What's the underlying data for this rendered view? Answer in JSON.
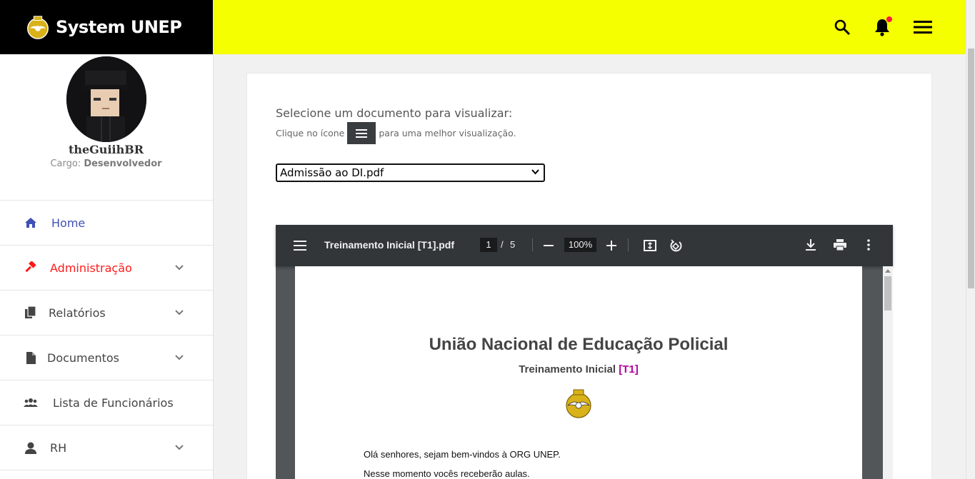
{
  "brand": {
    "name": "System UNEP",
    "logo_icon": "unep-emblem-icon"
  },
  "profile": {
    "username": "theGuiihBR",
    "role_label": "Cargo:",
    "role_value": "Desenvolvedor"
  },
  "sidebar": {
    "items": [
      {
        "label": "Home",
        "icon": "home-icon",
        "color": "#3f51b5",
        "has_chevron": false
      },
      {
        "label": "Administração",
        "icon": "gavel-icon",
        "color": "#ff1a1a",
        "has_chevron": true
      },
      {
        "label": "Relatórios",
        "icon": "files-icon",
        "color": "#444444",
        "has_chevron": true
      },
      {
        "label": "Documentos",
        "icon": "document-icon",
        "color": "#444444",
        "has_chevron": true
      },
      {
        "label": "Lista de Funcionários",
        "icon": "users-icon",
        "color": "#444444",
        "has_chevron": false
      },
      {
        "label": "RH",
        "icon": "user-icon",
        "color": "#444444",
        "has_chevron": true
      }
    ]
  },
  "header": {
    "background": "#f5ff00",
    "icons": [
      "search-icon",
      "bell-icon",
      "menu-icon"
    ],
    "notification_dot_color": "#ff1744"
  },
  "main": {
    "select_title": "Selecione um documento para visualizar:",
    "hint_before": "Clique no ícone",
    "hint_after": "para uma melhor visualização.",
    "selected_document": "Admissão ao DI.pdf"
  },
  "pdf_viewer": {
    "filename": "Treinamento Inicial [T1].pdf",
    "current_page": "1",
    "page_separator": "/",
    "total_pages": "5",
    "zoom": "100%",
    "document": {
      "title": "União Nacional de Educação Policial",
      "subtitle": "Treinamento Inicial",
      "subtitle_tag": "[T1]",
      "paragraphs": [
        "Olá senhores, sejam bem-vindos à ORG UNEP.",
        "Nesse momento vocês receberão aulas."
      ]
    }
  }
}
